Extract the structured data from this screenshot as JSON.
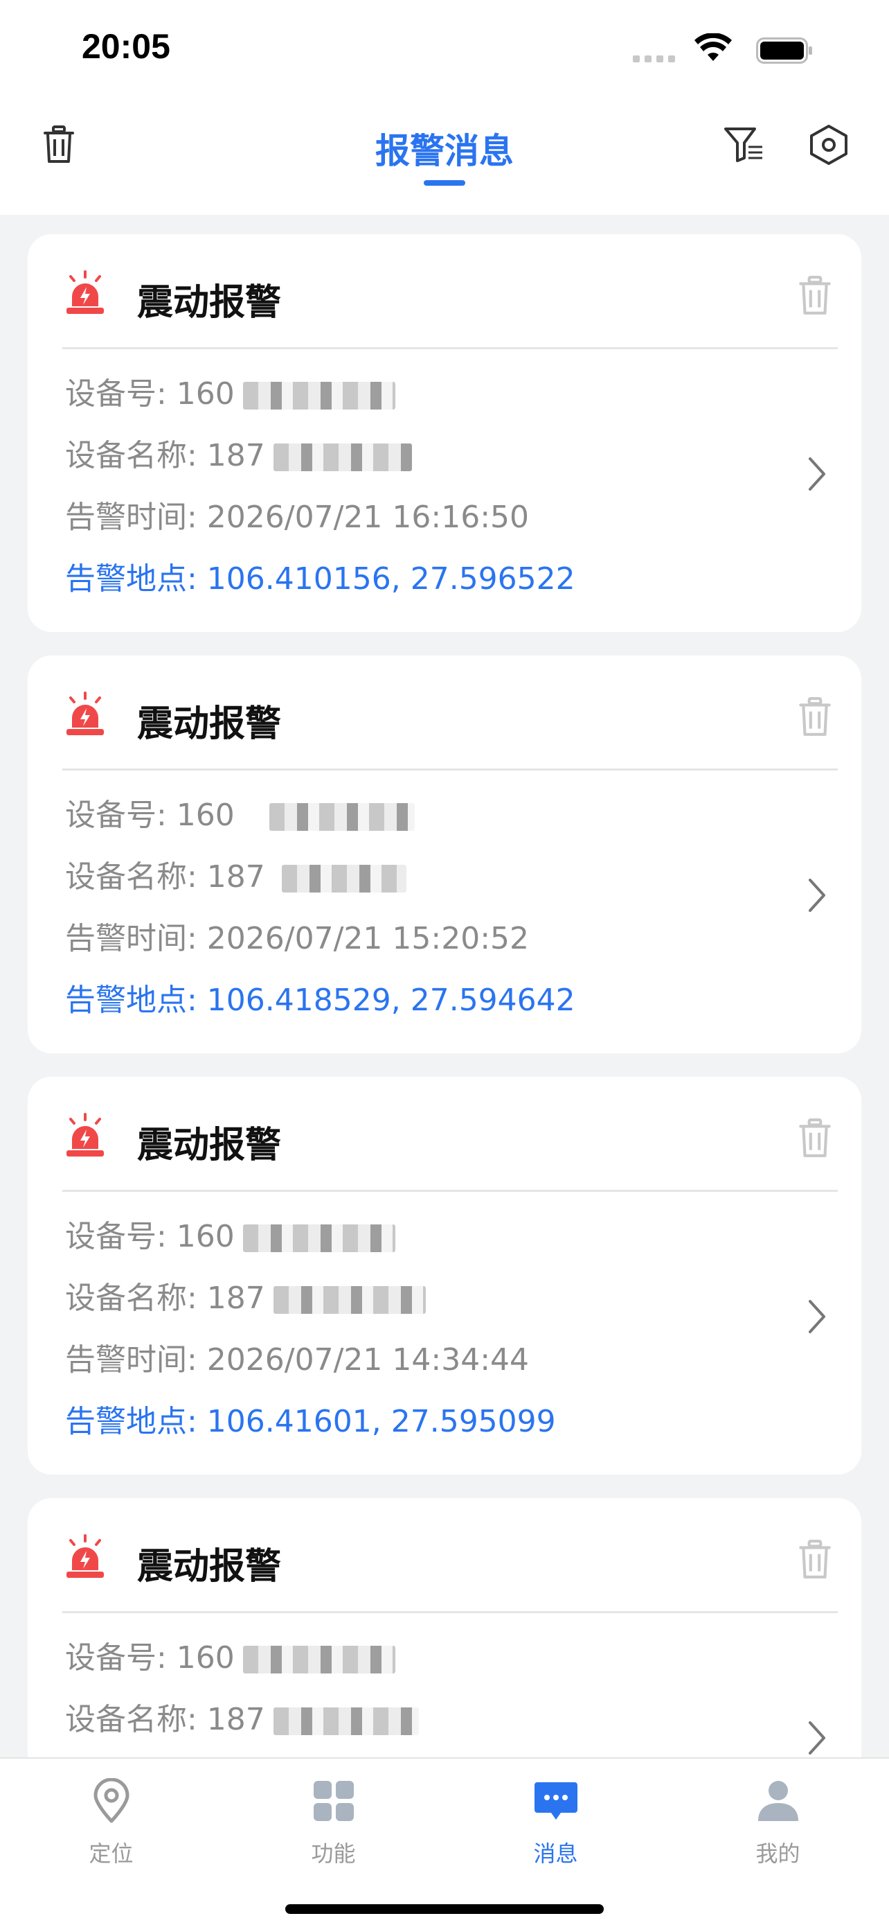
{
  "status_bar": {
    "time": "20:05"
  },
  "header": {
    "title": "报警消息",
    "icons": {
      "left": "trash-icon",
      "filter": "filter-list-icon",
      "settings": "hexagon-settings-icon"
    }
  },
  "colors": {
    "accent": "#2a74f0",
    "alarm_red": "#f04848",
    "muted": "#8a8a8a"
  },
  "alarms": [
    {
      "title": "震动报警",
      "device_no_label": "设备号: 160",
      "device_name_label": "设备名称: 187",
      "time": "告警时间: 2026/07/21 16:16:50",
      "location": "告警地点: 106.410156, 27.596522"
    },
    {
      "title": "震动报警",
      "device_no_label": "设备号: 160",
      "device_name_label": "设备名称: 187",
      "time": "告警时间: 2026/07/21 15:20:52",
      "location": "告警地点: 106.418529, 27.594642"
    },
    {
      "title": "震动报警",
      "device_no_label": "设备号: 160",
      "device_name_label": "设备名称: 187",
      "time": "告警时间: 2026/07/21 14:34:44",
      "location": "告警地点: 106.41601, 27.595099"
    },
    {
      "title": "震动报警",
      "device_no_label": "设备号: 160",
      "device_name_label": "设备名称: 187"
    }
  ],
  "tabs": [
    {
      "label": "定位",
      "icon": "location-pin-icon",
      "active": false
    },
    {
      "label": "功能",
      "icon": "grid-icon",
      "active": false
    },
    {
      "label": "消息",
      "icon": "message-icon",
      "active": true
    },
    {
      "label": "我的",
      "icon": "person-icon",
      "active": false
    }
  ]
}
